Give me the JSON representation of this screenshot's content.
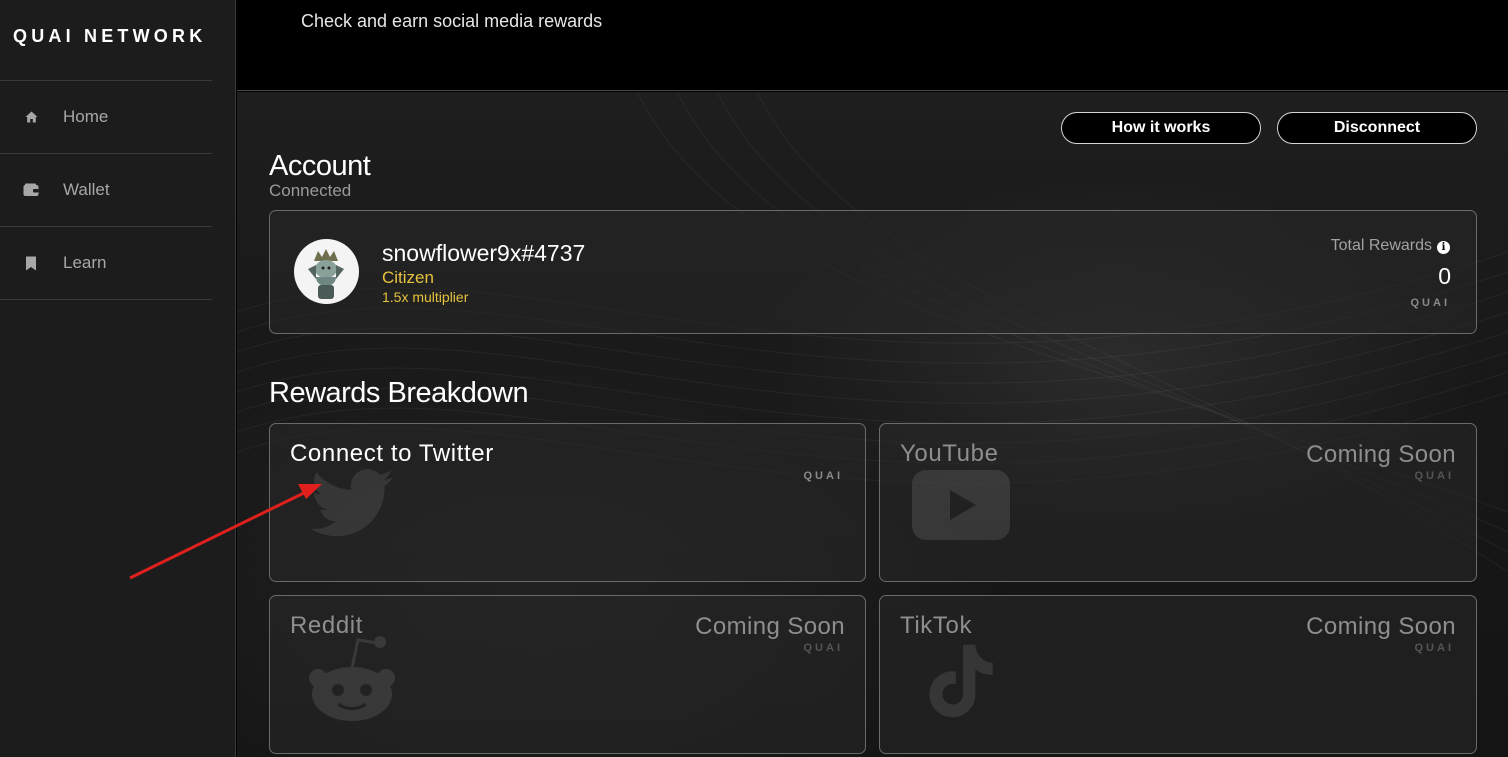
{
  "app": {
    "logo_text": "QUAI NETWORK"
  },
  "sidebar": {
    "items": [
      {
        "label": "Home",
        "icon": "home-icon"
      },
      {
        "label": "Wallet",
        "icon": "wallet-icon"
      },
      {
        "label": "Learn",
        "icon": "bookmark-icon"
      }
    ]
  },
  "header": {
    "subtitle": "Check and earn social media rewards"
  },
  "toolbar": {
    "how_it_works_label": "How it works",
    "disconnect_label": "Disconnect"
  },
  "account": {
    "title": "Account",
    "status": "Connected",
    "username": "snowflower9x#4737",
    "rank": "Citizen",
    "multiplier": "1.5x multiplier",
    "total_rewards_label": "Total Rewards",
    "total_rewards_value": "0",
    "currency": "QUAI"
  },
  "rewards": {
    "title": "Rewards Breakdown",
    "cards": [
      {
        "title": "Connect to Twitter",
        "status": "",
        "currency": "QUAI",
        "icon": "twitter-icon"
      },
      {
        "title": "YouTube",
        "status": "Coming Soon",
        "currency": "QUAI",
        "icon": "youtube-icon"
      },
      {
        "title": "Reddit",
        "status": "Coming Soon",
        "currency": "QUAI",
        "icon": "reddit-icon"
      },
      {
        "title": "TikTok",
        "status": "Coming Soon",
        "currency": "QUAI",
        "icon": "tiktok-icon"
      }
    ]
  },
  "colors": {
    "accent_gold": "#e6c33f",
    "annotation_arrow": "#e0201c",
    "sidebar_bg": "#1c1c1c"
  }
}
